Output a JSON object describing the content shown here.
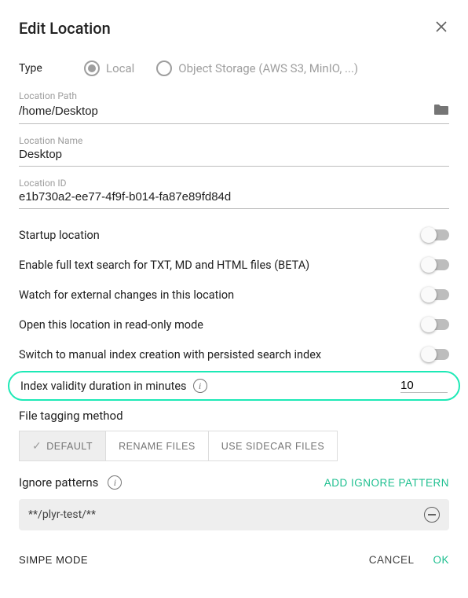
{
  "title": "Edit Location",
  "type": {
    "label": "Type",
    "options": {
      "local": "Local",
      "object": "Object Storage (AWS S3, MinIO, ...)"
    },
    "selected": "local"
  },
  "fields": {
    "path": {
      "label": "Location Path",
      "value": "/home/Desktop"
    },
    "name": {
      "label": "Location Name",
      "value": "Desktop"
    },
    "id": {
      "label": "Location ID",
      "value": "e1b730a2-ee77-4f9f-b014-fa87e89fd84d"
    }
  },
  "toggles": {
    "startup": {
      "label": "Startup location",
      "checked": false
    },
    "fulltext": {
      "label": "Enable full text search for TXT, MD and HTML files (BETA)",
      "checked": false
    },
    "watch": {
      "label": "Watch for external changes in this location",
      "checked": false
    },
    "readonly": {
      "label": "Open this location in read-only mode",
      "checked": false
    },
    "manual": {
      "label": "Switch to manual index creation with persisted search index",
      "checked": false
    }
  },
  "index_validity": {
    "label": "Index validity duration in minutes",
    "value": "10"
  },
  "tagging": {
    "label": "File tagging method",
    "options": {
      "default": "DEFAULT",
      "rename": "RENAME FILES",
      "sidecar": "USE SIDECAR FILES"
    },
    "selected": "default"
  },
  "ignore": {
    "label": "Ignore patterns",
    "add_label": "ADD IGNORE PATTERN",
    "patterns": [
      "**/plyr-test/**"
    ]
  },
  "footer": {
    "simple_mode": "SIMPE MODE",
    "cancel": "CANCEL",
    "ok": "OK"
  }
}
